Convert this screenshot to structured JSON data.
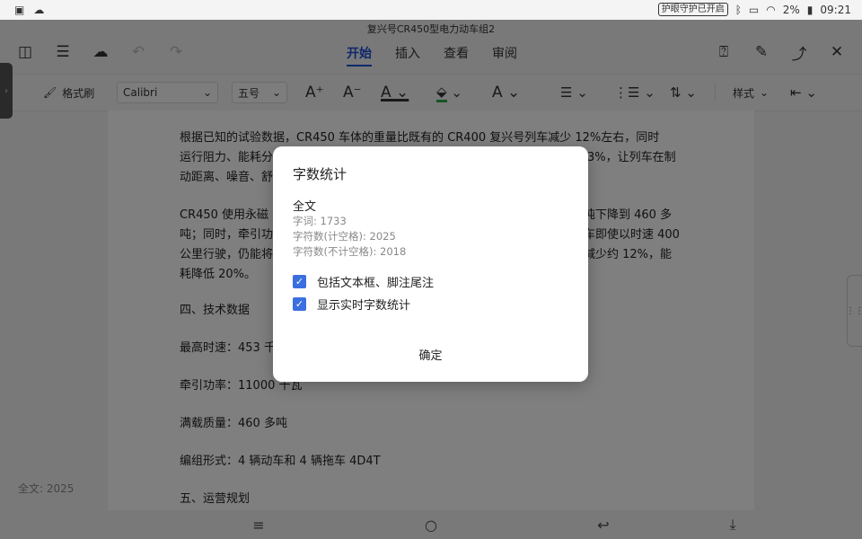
{
  "status_bar": {
    "eye_protection": "护眼守护已开启",
    "battery": "2%",
    "time": "09:21"
  },
  "doc_title": "复兴号CR450型电力动车组2",
  "tabs": [
    {
      "label": "开始",
      "active": true
    },
    {
      "label": "插入",
      "active": false
    },
    {
      "label": "查看",
      "active": false
    },
    {
      "label": "审阅",
      "active": false
    }
  ],
  "toolbar": {
    "format_painter": "格式刷",
    "font_name": "Calibri",
    "font_size": "五号",
    "styles": "样式"
  },
  "document": {
    "paragraphs": [
      "根据已知的试验数据，CR450 车体的重量比既有的 CR400 复兴号列车减少 12%左右，同时",
      "运行阻力、能耗分",
      "3%，让列车在制",
      "动距离、噪音、舒",
      "CR450 使用永磁",
      "吨下降到 460 多",
      "吨；同时，牵引功",
      "车即使以时速 400",
      "公里行驶，仍能将",
      "减少约 12%，能",
      "耗降低 20%。",
      "四、技术数据",
      "最高时速：453 千",
      "牵引功率：11000 千瓦",
      "满载质量：460 多吨",
      "编组形式：4 辆动车和 4 辆拖车 4D4T",
      "五、运营规划"
    ]
  },
  "footer_word_count": "全文: 2025",
  "dialog": {
    "title": "字数统计",
    "section": "全文",
    "stats": [
      "字词: 1733",
      "字符数(计空格): 2025",
      "字符数(不计空格): 2018"
    ],
    "options": [
      {
        "label": "包括文本框、脚注尾注",
        "checked": true
      },
      {
        "label": "显示实时字数统计",
        "checked": true
      }
    ],
    "confirm": "确定"
  },
  "colors": {
    "accent": "#1d4ed8",
    "checkbox": "#3b6fe0"
  }
}
